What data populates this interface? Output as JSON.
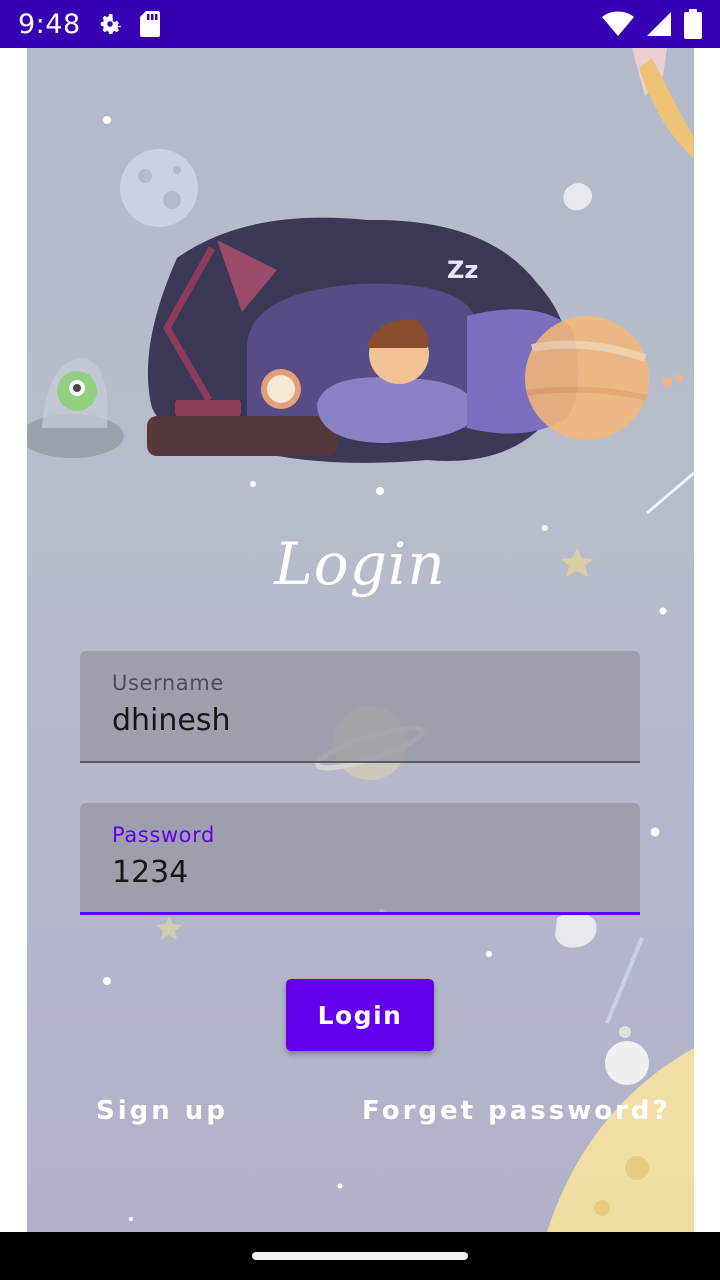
{
  "status_bar": {
    "time": "9:48",
    "left_icons": [
      "settings-icon",
      "sd-card-icon"
    ],
    "right_icons": [
      "wifi-icon",
      "signal-icon",
      "battery-icon"
    ],
    "color": "#3700b3"
  },
  "screen": {
    "heading": "Login",
    "username": {
      "label": "Username",
      "value": "dhinesh"
    },
    "password": {
      "label": "Password",
      "value": "1234"
    },
    "login_button": "Login",
    "signup_link": "Sign up",
    "forget_link": "Forget password?"
  },
  "colors": {
    "accent": "#6200ee",
    "status_bar": "#3700b3"
  }
}
